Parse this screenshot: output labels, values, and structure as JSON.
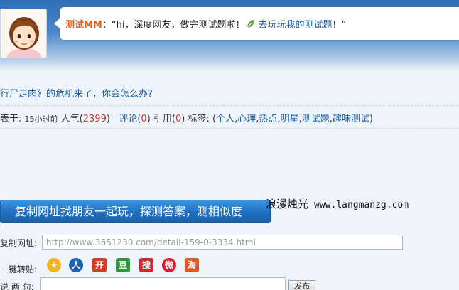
{
  "speech": {
    "name": "测试MM",
    "colon": "：",
    "message": "“hi，深度网友，做完测试题啦！",
    "link": "去玩玩我的测试题",
    "tail": "！”"
  },
  "post": {
    "title": "行尸走肉》的危机来了，你会怎么办?",
    "meta_prefix": "表于:",
    "time": "15小时前",
    "popularity_label": "人气(",
    "popularity": "2399",
    "close": ")",
    "comments_label": "评论(",
    "comments": "0",
    "refs_label": "引用(",
    "refs": "0",
    "tags_label": "标签:",
    "tags_open": "(",
    "tags": [
      "个人",
      "心理",
      "热点",
      "明星",
      "测试题",
      "趣味测试"
    ],
    "tags_close": ")"
  },
  "share": {
    "button_label": "复制网址找朋友一起玩，探测答案，测相似度",
    "url_label": "复制网址:",
    "url_value": "http://www.3651230.com/detail-159-0-3334.html",
    "repost_label": "一键转贴:",
    "say_label": "说 两 句:",
    "post_label": "发布",
    "icons": [
      {
        "name": "qzone-icon",
        "color": "#f2b31c"
      },
      {
        "name": "renren-icon",
        "color": "#1f5fb2"
      },
      {
        "name": "kaixin-icon",
        "color": "#d93a25"
      },
      {
        "name": "douban-icon",
        "color": "#2e963d"
      },
      {
        "name": "sohu-icon",
        "color": "#d9232e"
      },
      {
        "name": "weibo-icon",
        "color": "#e6162d"
      },
      {
        "name": "taobao-icon",
        "color": "#e8541e"
      }
    ]
  },
  "watermark": {
    "cn": "浪漫烛光",
    "url": "www.langmanzg.com"
  },
  "colors": {
    "header_blue": "#2f6fb6",
    "link_blue": "#1c5b9c",
    "button_blue": "#1f6fc0",
    "name_orange": "#e0611a"
  }
}
